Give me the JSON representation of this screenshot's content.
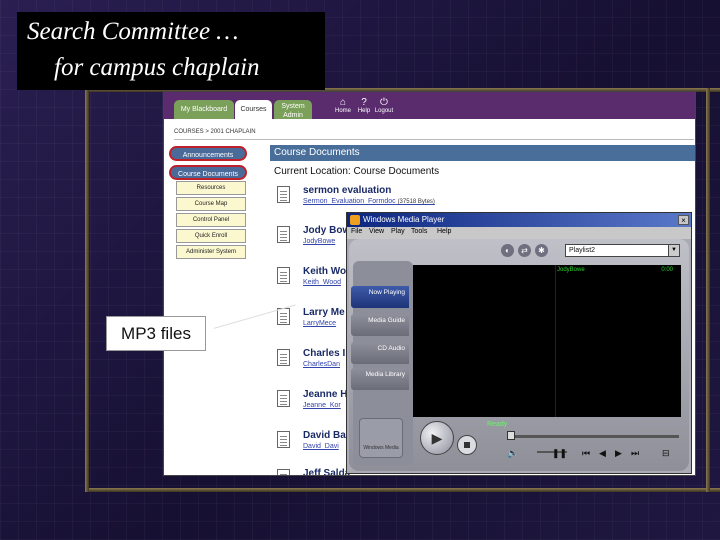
{
  "slide": {
    "title_line1": "Search Committee …",
    "title_line2": "for campus chaplain",
    "callout": "MP3 files"
  },
  "blackboard": {
    "tabs": {
      "my_blackboard": "My Blackboard",
      "courses": "Courses",
      "system_admin": "System Admin"
    },
    "header_icons": [
      {
        "label": "Home",
        "icon": "home-icon"
      },
      {
        "label": "Help",
        "icon": "help-icon"
      },
      {
        "label": "Logout",
        "icon": "logout-icon"
      }
    ],
    "breadcrumb": "COURSES > 2001 CHAPLAIN",
    "nav_primary": [
      "Announcements",
      "Course Documents"
    ],
    "nav_secondary": [
      "Resources",
      "Course Map",
      "Control Panel",
      "Quick Enroll",
      "Administer System"
    ],
    "section_title": "Course Documents",
    "current_location": "Current Location: Course Documents",
    "documents": [
      {
        "title": "sermon evaluation",
        "link": "Sermon_Evaluation_Formdoc",
        "size": "(37518 Bytes)"
      },
      {
        "title": "Jody Bow",
        "link": "JodyBowe",
        "size": ""
      },
      {
        "title": "Keith Wo",
        "link": "Keith_Wood",
        "size": ""
      },
      {
        "title": "Larry Me",
        "link": "LarryMece",
        "size": ""
      },
      {
        "title": "Charles I",
        "link": "CharlesDan",
        "size": ""
      },
      {
        "title": "Jeanne H",
        "link": "Jeanne_Kor",
        "size": ""
      },
      {
        "title": "David Ba",
        "link": "David_Davi",
        "size": ""
      },
      {
        "title": "Jeff Salda",
        "link": "",
        "size": ""
      }
    ]
  },
  "media_player": {
    "title": "Windows Media Player",
    "close": "×",
    "menus": [
      "File",
      "View",
      "Play",
      "Tools",
      "Help"
    ],
    "playlist": "Playlist2",
    "taskbar": [
      "Now Playing",
      "Media Guide",
      "CD Audio",
      "Media Library"
    ],
    "now_playing": "JodyBowe",
    "time": "0:00",
    "status": "Ready",
    "logo_text": "Windows Media"
  }
}
